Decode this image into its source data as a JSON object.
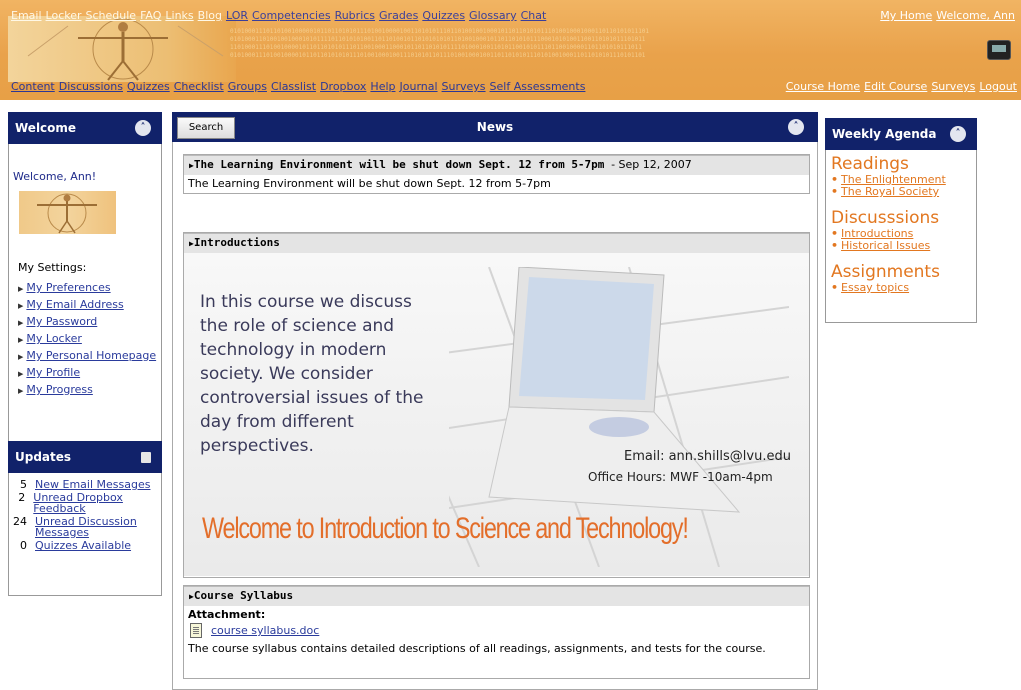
{
  "top_nav": [
    "Email",
    "Locker",
    "Schedule",
    "FAQ",
    "Links",
    "Blog",
    "LOR",
    "Competencies",
    "Rubrics",
    "Grades",
    "Quizzes",
    "Glossary",
    "Chat"
  ],
  "top_right": [
    "My Home",
    "Welcome, Ann"
  ],
  "course_nav": [
    "Content",
    "Discussions",
    "Quizzes",
    "Checklist",
    "Groups",
    "Classlist",
    "Dropbox",
    "Help",
    "Journal",
    "Surveys",
    "Self Assessments"
  ],
  "course_right": [
    "Course Home",
    "Edit Course",
    "Surveys",
    "Logout"
  ],
  "binary_rows": [
    "01010001110110100100000101101101010111010010000100110101011101101001001000101101101010111010010001000110110101011101",
    "0101000110100100100010101111011010101001101101001011010101010110100100010110110101011100010101001100110101011101011",
    "110100011101001000010110110101011101100100011000101101101010111101000100110101100101011101100100001101101010111011",
    "0101000111010010000101101101010101110100100010011101010110111010010001001101101010111010100100011011010101110101101"
  ],
  "welcome_panel": {
    "title": "Welcome",
    "greeting": "Welcome, Ann!",
    "settings_label": "My Settings:",
    "settings": [
      "My Preferences",
      "My Email Address",
      "My Password",
      "My Locker",
      "My Personal Homepage",
      "My Profile",
      "My Progress"
    ]
  },
  "updates_panel": {
    "title": "Updates",
    "rows": [
      {
        "count": "5",
        "label": "New Email Messages"
      },
      {
        "count": "2",
        "label": "Unread Dropbox Feedback"
      },
      {
        "count": "24",
        "label": "Unread Discussion Messages"
      },
      {
        "count": "0",
        "label": "Quizzes Available"
      }
    ]
  },
  "news": {
    "search_label": "Search",
    "title": "News",
    "item1": {
      "title": "The Learning Environment will be shut down Sept. 12 from 5-7pm",
      "date": "- Sep 12, 2007",
      "body": "The Learning Environment will be shut down Sept. 12 from 5-7pm"
    },
    "item2": {
      "title": "Introductions",
      "promo_text": "In this course we discuss the role of science and technology in modern society. We consider controversial issues of the day from different perspectives.",
      "email": "Email: ann.shills@lvu.edu",
      "hours": "Office Hours: MWF -10am-4pm",
      "welcome": "Welcome to Introduction to Science and Technology!"
    },
    "item3": {
      "title": "Course Syllabus",
      "attachment_label": "Attachment:",
      "file": "course syllabus.doc",
      "body": "The course syllabus contains detailed descriptions of all readings, assignments, and tests for the course."
    }
  },
  "agenda": {
    "title": "Weekly Agenda",
    "sections": [
      {
        "heading": "Readings",
        "links": [
          "The Enlightenment",
          "The Royal Society"
        ]
      },
      {
        "heading": "Discusssions",
        "links": [
          "Introductions",
          "Historical Issues"
        ]
      },
      {
        "heading": "Assignments",
        "links": [
          "Essay topics"
        ]
      }
    ]
  }
}
